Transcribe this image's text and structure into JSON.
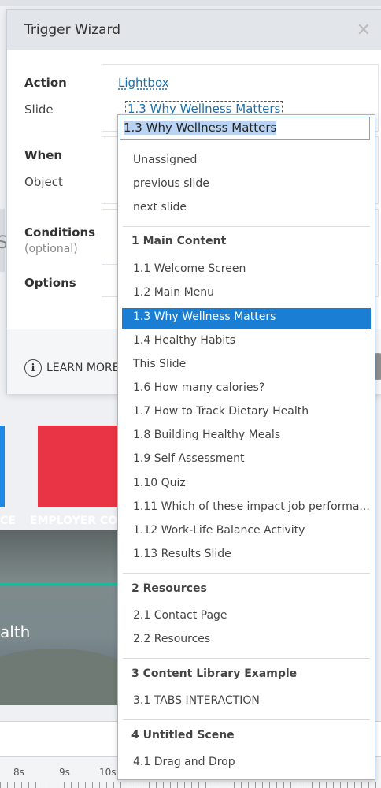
{
  "dialog": {
    "title": "Trigger Wizard",
    "close_icon": "close-icon",
    "labels": {
      "action": "Action",
      "slide": "Slide",
      "when": "When",
      "object": "Object",
      "conditions": "Conditions",
      "conditions_hint": "(optional)",
      "options": "Options"
    },
    "action_value": "Lightbox",
    "slide_value": "1.3 Why Wellness Matters",
    "learn_more": "LEARN MORE"
  },
  "dropdown": {
    "input_value": "1.3 Why Wellness Matters",
    "items": [
      {
        "kind": "item",
        "label": "Unassigned"
      },
      {
        "kind": "item",
        "label": "previous slide"
      },
      {
        "kind": "item",
        "label": "next slide"
      },
      {
        "kind": "group",
        "label": "1 Main Content"
      },
      {
        "kind": "item",
        "label": "1.1 Welcome Screen"
      },
      {
        "kind": "item",
        "label": "1.2 Main Menu"
      },
      {
        "kind": "item",
        "label": "1.3 Why Wellness Matters",
        "selected": true
      },
      {
        "kind": "item",
        "label": "1.4 Healthy Habits"
      },
      {
        "kind": "item",
        "label": "This Slide"
      },
      {
        "kind": "item",
        "label": "1.6 How many calories?"
      },
      {
        "kind": "item",
        "label": "1.7 How to Track Dietary Health"
      },
      {
        "kind": "item",
        "label": "1.8 Building Healthy Meals"
      },
      {
        "kind": "item",
        "label": "1.9 Self Assessment"
      },
      {
        "kind": "item",
        "label": "1.10 Quiz"
      },
      {
        "kind": "item",
        "label": "1.11 Which of these impact job performa..."
      },
      {
        "kind": "item",
        "label": "1.12 Work-Life Balance Activity"
      },
      {
        "kind": "item",
        "label": "1.13 Results Slide"
      },
      {
        "kind": "group",
        "label": "2 Resources"
      },
      {
        "kind": "item",
        "label": "2.1 Contact Page"
      },
      {
        "kind": "item",
        "label": "2.2 Resources"
      },
      {
        "kind": "group",
        "label": "3 Content Library Example"
      },
      {
        "kind": "item",
        "label": "3.1 TABS INTERACTION"
      },
      {
        "kind": "group",
        "label": "4 Untitled Scene"
      },
      {
        "kind": "item",
        "label": "4.1 Drag and Drop"
      }
    ]
  },
  "background": {
    "canvas_labels": [
      "CE",
      "EMPLOYER COS",
      "alth"
    ],
    "glyph": "S",
    "timeline_ticks": [
      "8s",
      "9s",
      "10s"
    ]
  },
  "colors": {
    "selection": "#1a7fd4",
    "link": "#1d6fa8",
    "red_tile": "#e93445",
    "blue_tile": "#1e88e5",
    "teal_line": "#1fb89a"
  }
}
